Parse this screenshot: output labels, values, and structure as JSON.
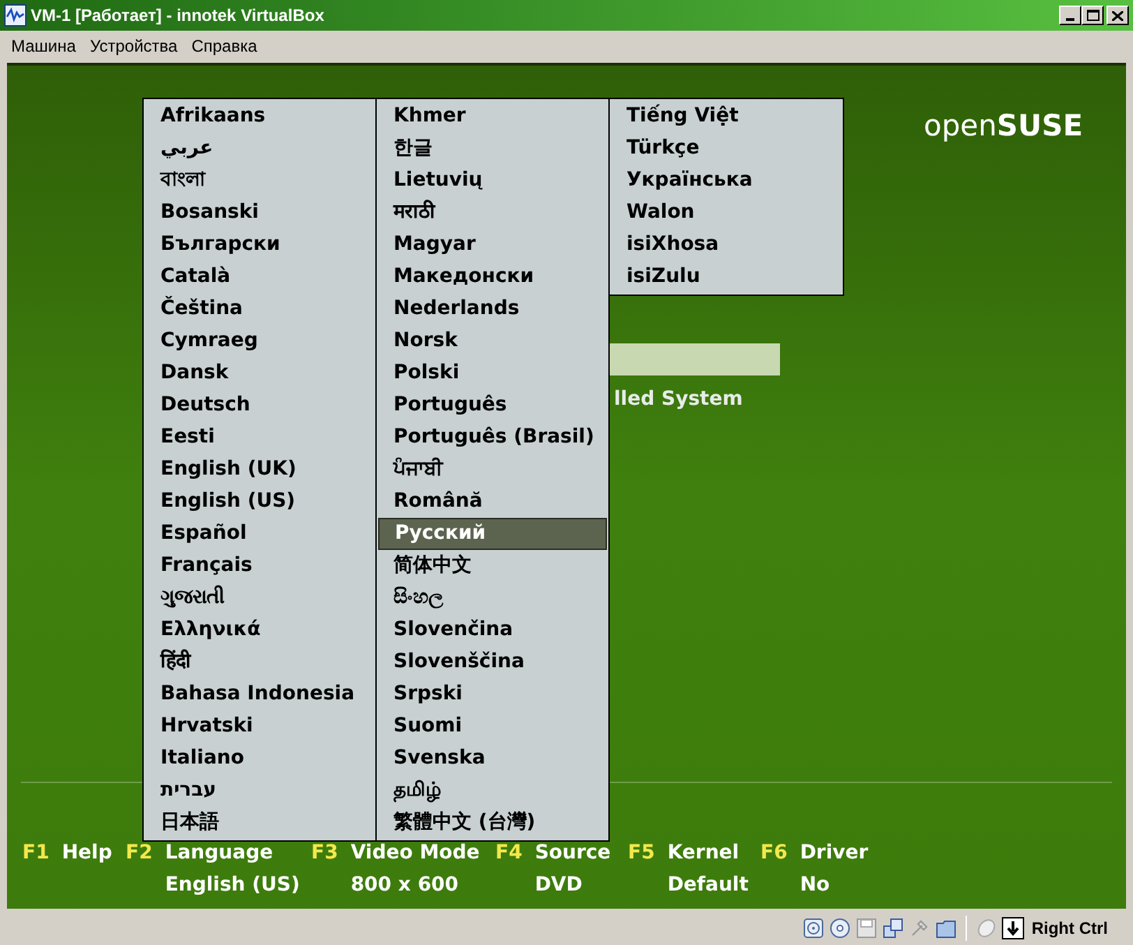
{
  "window": {
    "title": "VM-1 [Работает] - innotek VirtualBox"
  },
  "menu_bar": [
    "Машина",
    "Устройства",
    "Справка"
  ],
  "logo": "open**SUSE**",
  "boot_menu": {
    "items": [
      {
        "selected": true
      },
      {
        "label": "lled System",
        "selected": false
      }
    ]
  },
  "language_menu": {
    "columns": [
      [
        {
          "label": "Afrikaans",
          "selected": false
        },
        {
          "label": "عربي",
          "selected": false
        },
        {
          "label": "বাংলা",
          "selected": false
        },
        {
          "label": "Bosanski",
          "selected": false
        },
        {
          "label": "Български",
          "selected": false
        },
        {
          "label": "Català",
          "selected": false
        },
        {
          "label": "Čeština",
          "selected": false
        },
        {
          "label": "Cymraeg",
          "selected": false
        },
        {
          "label": "Dansk",
          "selected": false
        },
        {
          "label": "Deutsch",
          "selected": false
        },
        {
          "label": "Eesti",
          "selected": false
        },
        {
          "label": "English (UK)",
          "selected": false
        },
        {
          "label": "English (US)",
          "selected": false
        },
        {
          "label": "Español",
          "selected": false
        },
        {
          "label": "Français",
          "selected": false
        },
        {
          "label": "ગુજરાતી",
          "selected": false
        },
        {
          "label": "Ελληνικά",
          "selected": false
        },
        {
          "label": "हिंदी",
          "selected": false
        },
        {
          "label": "Bahasa Indonesia",
          "selected": false
        },
        {
          "label": "Hrvatski",
          "selected": false
        },
        {
          "label": "Italiano",
          "selected": false
        },
        {
          "label": "עברית",
          "selected": false
        },
        {
          "label": "日本語",
          "selected": false
        }
      ],
      [
        {
          "label": "Khmer",
          "selected": false
        },
        {
          "label": "한글",
          "selected": false
        },
        {
          "label": "Lietuvių",
          "selected": false
        },
        {
          "label": "मराठी",
          "selected": false
        },
        {
          "label": "Magyar",
          "selected": false
        },
        {
          "label": "Македонски",
          "selected": false
        },
        {
          "label": "Nederlands",
          "selected": false
        },
        {
          "label": "Norsk",
          "selected": false
        },
        {
          "label": "Polski",
          "selected": false
        },
        {
          "label": "Português",
          "selected": false
        },
        {
          "label": "Português (Brasil)",
          "selected": false
        },
        {
          "label": "ਪੰਜਾਬੀ",
          "selected": false
        },
        {
          "label": "Română",
          "selected": false
        },
        {
          "label": "Русский",
          "selected": true
        },
        {
          "label": "简体中文",
          "selected": false
        },
        {
          "label": "සිංහල",
          "selected": false
        },
        {
          "label": "Slovenčina",
          "selected": false
        },
        {
          "label": "Slovenščina",
          "selected": false
        },
        {
          "label": "Srpski",
          "selected": false
        },
        {
          "label": "Suomi",
          "selected": false
        },
        {
          "label": "Svenska",
          "selected": false
        },
        {
          "label": "தமிழ்",
          "selected": false
        },
        {
          "label": "繁體中文 (台灣)",
          "selected": false
        }
      ],
      [
        {
          "label": "Tiếng Việt",
          "selected": false
        },
        {
          "label": "Türkçe",
          "selected": false
        },
        {
          "label": "Українська",
          "selected": false
        },
        {
          "label": "Walon",
          "selected": false
        },
        {
          "label": "isiXhosa",
          "selected": false
        },
        {
          "label": "isiZulu",
          "selected": false
        }
      ]
    ]
  },
  "function_keys": [
    {
      "key": "F1",
      "label": "Help"
    },
    {
      "key": "F2",
      "label": "Language",
      "value": "English (US)"
    },
    {
      "key": "F3",
      "label": "Video Mode",
      "value": "800 x 600"
    },
    {
      "key": "F4",
      "label": "Source",
      "value": "DVD"
    },
    {
      "key": "F5",
      "label": "Kernel",
      "value": "Default"
    },
    {
      "key": "F6",
      "label": "Driver",
      "value": "No"
    }
  ],
  "status_bar": {
    "host_key": "Right Ctrl"
  }
}
